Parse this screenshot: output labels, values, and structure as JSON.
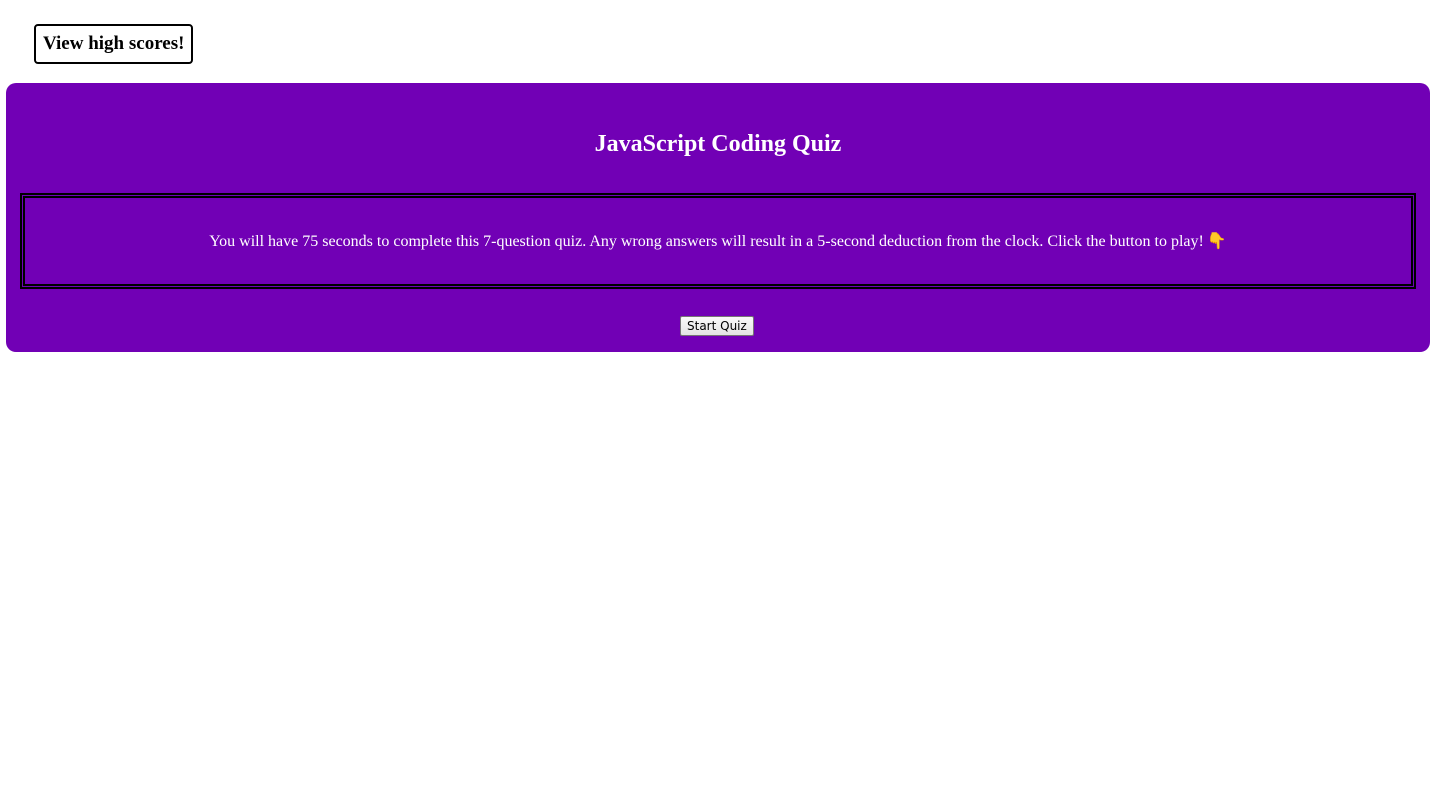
{
  "header": {
    "high_scores_label": "View high scores!"
  },
  "quiz": {
    "title": "JavaScript Coding Quiz",
    "instructions": "You will have 75 seconds to complete this 7-question quiz. Any wrong answers will result in a 5-second deduction from the clock. Click the button to play!",
    "pointer_icon": "pointing-down-hand-icon",
    "pointer_glyph": "👇",
    "start_label": "Start Quiz"
  },
  "colors": {
    "card_background": "#7100b5",
    "text_on_card": "#ffffff"
  }
}
